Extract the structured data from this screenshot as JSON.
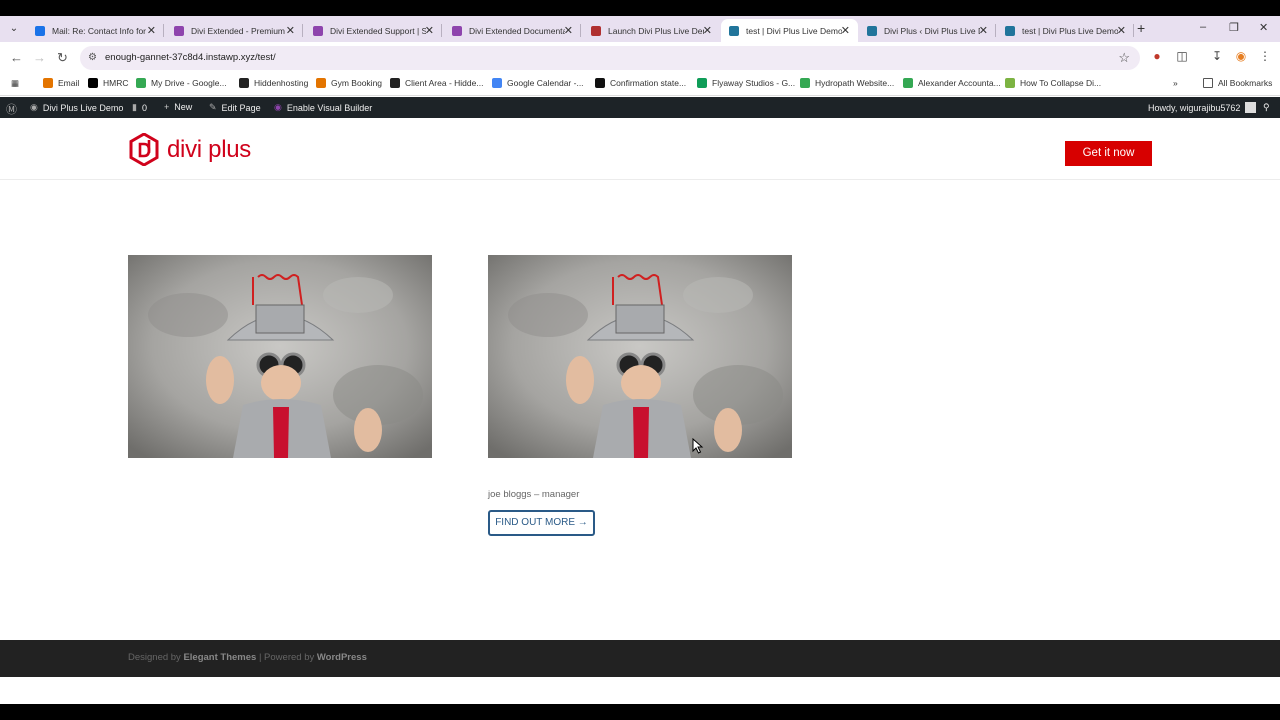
{
  "browser": {
    "tabs": [
      {
        "title": "Mail: Re: Contact Info for",
        "color": "#1a73e8"
      },
      {
        "title": "Divi Extended - Premium",
        "color": "#8e44ad"
      },
      {
        "title": "Divi Extended Support | S",
        "color": "#8e44ad"
      },
      {
        "title": "Divi Extended Documenta",
        "color": "#8e44ad"
      },
      {
        "title": "Launch Divi Plus Live Dem",
        "color": "#b03030"
      },
      {
        "title": "test | Divi Plus Live Demo",
        "color": "#21759b"
      },
      {
        "title": "Divi Plus ‹ Divi Plus Live D",
        "color": "#21759b"
      },
      {
        "title": "test | Divi Plus Live Demo",
        "color": "#21759b"
      }
    ],
    "active_tab": 5,
    "url": "enough-gannet-37c8d4.instawp.xyz/test/"
  },
  "bookmarks": [
    {
      "label": "Email",
      "color": "#e37400"
    },
    {
      "label": "HMRC",
      "color": "#000000"
    },
    {
      "label": "My Drive - Google...",
      "color": "#34a853"
    },
    {
      "label": "Hiddenhosting",
      "color": "#222222"
    },
    {
      "label": "Gym Booking",
      "color": "#e37400"
    },
    {
      "label": "Client Area - Hidde...",
      "color": "#222222"
    },
    {
      "label": "Google Calendar -...",
      "color": "#4285f4"
    },
    {
      "label": "Confirmation state...",
      "color": "#111111"
    },
    {
      "label": "Flyaway Studios - G...",
      "color": "#0f9d58"
    },
    {
      "label": "Hydropath Website...",
      "color": "#34a853"
    },
    {
      "label": "Alexander Accounta...",
      "color": "#34a853"
    },
    {
      "label": "How To Collapse Di...",
      "color": "#7cb342"
    }
  ],
  "bookmarks_all": "All Bookmarks",
  "adminbar": {
    "site_name": "Divi Plus Live Demo",
    "comments": "0",
    "new_label": "New",
    "edit_label": "Edit Page",
    "builder_label": "Enable Visual Builder",
    "howdy": "Howdy, wigurajibu5762"
  },
  "site": {
    "logo_text": "divi plus",
    "cta_label": "Get it now",
    "brand_color": "#d70000"
  },
  "main": {
    "member_caption": "joe bloggs – manager",
    "button_label": "FIND OUT MORE →"
  },
  "footer": {
    "designed_by": "Designed by ",
    "elegant": "Elegant Themes",
    "sep": " | Powered by ",
    "wordpress": "WordPress"
  }
}
